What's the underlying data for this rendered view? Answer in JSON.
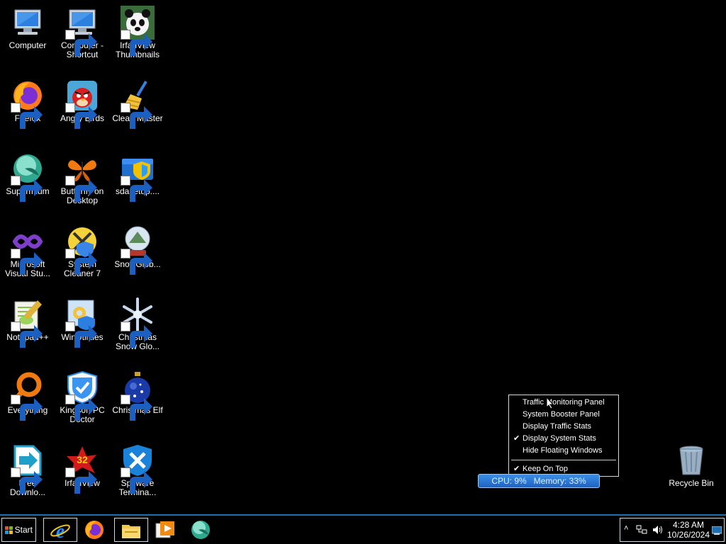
{
  "desktop_icons": [
    {
      "label": "Computer",
      "icon": "computer-icon",
      "shortcut": false
    },
    {
      "label": "Computer -\nShortcut",
      "icon": "computer-icon",
      "shortcut": true
    },
    {
      "label": "IrfanView\nThumbnails",
      "icon": "panda-icon",
      "shortcut": true
    },
    {
      "label": "Firefox",
      "icon": "firefox-icon",
      "shortcut": true
    },
    {
      "label": "Angry Birds",
      "icon": "angry-bird-icon",
      "shortcut": true
    },
    {
      "label": "Clean Master",
      "icon": "broom-icon",
      "shortcut": true
    },
    {
      "label": "Supermium",
      "icon": "supermium-icon",
      "shortcut": true
    },
    {
      "label": "Butterfly on\nDesktop",
      "icon": "butterfly-icon",
      "shortcut": true
    },
    {
      "label": "sdasetup....",
      "icon": "installer-icon",
      "shortcut": true
    },
    {
      "label": "Microsoft\nVisual Stu...",
      "icon": "visual-studio-icon",
      "shortcut": true
    },
    {
      "label": "System\nCleaner 7",
      "icon": "system-cleaner-icon",
      "shortcut": true
    },
    {
      "label": "SnowGlob...",
      "icon": "snow-globe-icon",
      "shortcut": true
    },
    {
      "label": "Notepad++",
      "icon": "notepad-plus-icon",
      "shortcut": true
    },
    {
      "label": "WinUtilities",
      "icon": "winutilities-icon",
      "shortcut": true
    },
    {
      "label": "Christmas\nSnow Glo...",
      "icon": "snowflake-icon",
      "shortcut": true
    },
    {
      "label": "Everything",
      "icon": "everything-icon",
      "shortcut": true
    },
    {
      "label": "Kingsoft PC\nDoctor",
      "icon": "shield-check-icon",
      "shortcut": true
    },
    {
      "label": "Christmas Elf",
      "icon": "christmas-ornament-icon",
      "shortcut": true
    },
    {
      "label": "Free\nDownlo...",
      "icon": "download-arrow-icon",
      "shortcut": true
    },
    {
      "label": "IrfanView",
      "icon": "irfanview-icon",
      "shortcut": true
    },
    {
      "label": "Spyware\nTermina...",
      "icon": "spyware-shield-icon",
      "shortcut": true
    },
    {
      "label": "Recycle Bin",
      "icon": "recycle-bin-icon",
      "shortcut": false
    }
  ],
  "context_menu": {
    "items": [
      {
        "label": "Traffic Monitoring Panel",
        "checked": false
      },
      {
        "label": "System Booster Panel",
        "checked": false
      },
      {
        "label": "Display Traffic Stats",
        "checked": false
      },
      {
        "label": "Display System Stats",
        "checked": true
      },
      {
        "label": "Hide Floating Windows",
        "checked": false
      }
    ],
    "bottom_item": {
      "label": "Keep On Top",
      "checked": true
    },
    "check_glyph": "✔"
  },
  "stats_widget": {
    "text": "CPU: 9%   Memory: 33%"
  },
  "taskbar": {
    "start_label": "Start",
    "pinned": [
      "internet-explorer-icon",
      "firefox-icon",
      "file-explorer-icon",
      "media-player-icon",
      "supermium-icon"
    ],
    "tray": {
      "chevron": "˄",
      "time": "4:28 AM",
      "date": "10/26/2024"
    }
  },
  "colors": {
    "taskbar_accent": "#1a6fb5",
    "stats_bg": "#2a78d8"
  }
}
